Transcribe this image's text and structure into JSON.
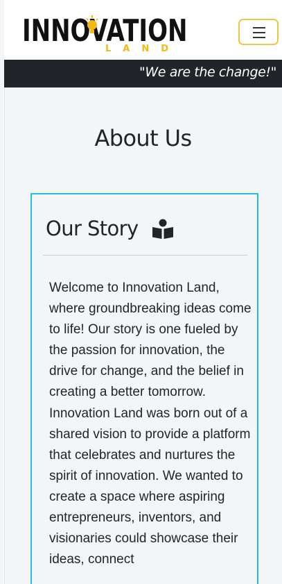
{
  "brand": {
    "logo_main": "INNOVATION",
    "logo_sub": "LAND"
  },
  "header": {
    "tagline": "\"We are the change!\"",
    "menu_icon": "hamburger-menu-icon",
    "accent_color": "#f0c542"
  },
  "main": {
    "title": "About Us",
    "story": {
      "heading": "Our Story",
      "icon": "book-reader-icon",
      "border_color": "#1fc1dc",
      "text": "Welcome to Innovation Land, where groundbreaking ideas come to life! Our story is one fueled by the passion for innovation, the drive for change, and the belief in creating a better tomorrow. Innovation Land was born out of a shared vision to provide a platform that celebrates and nurtures the spirit of innovation. We wanted to create a space where aspiring entrepreneurs, inventors, and visionaries could showcase their ideas, connect"
    }
  }
}
